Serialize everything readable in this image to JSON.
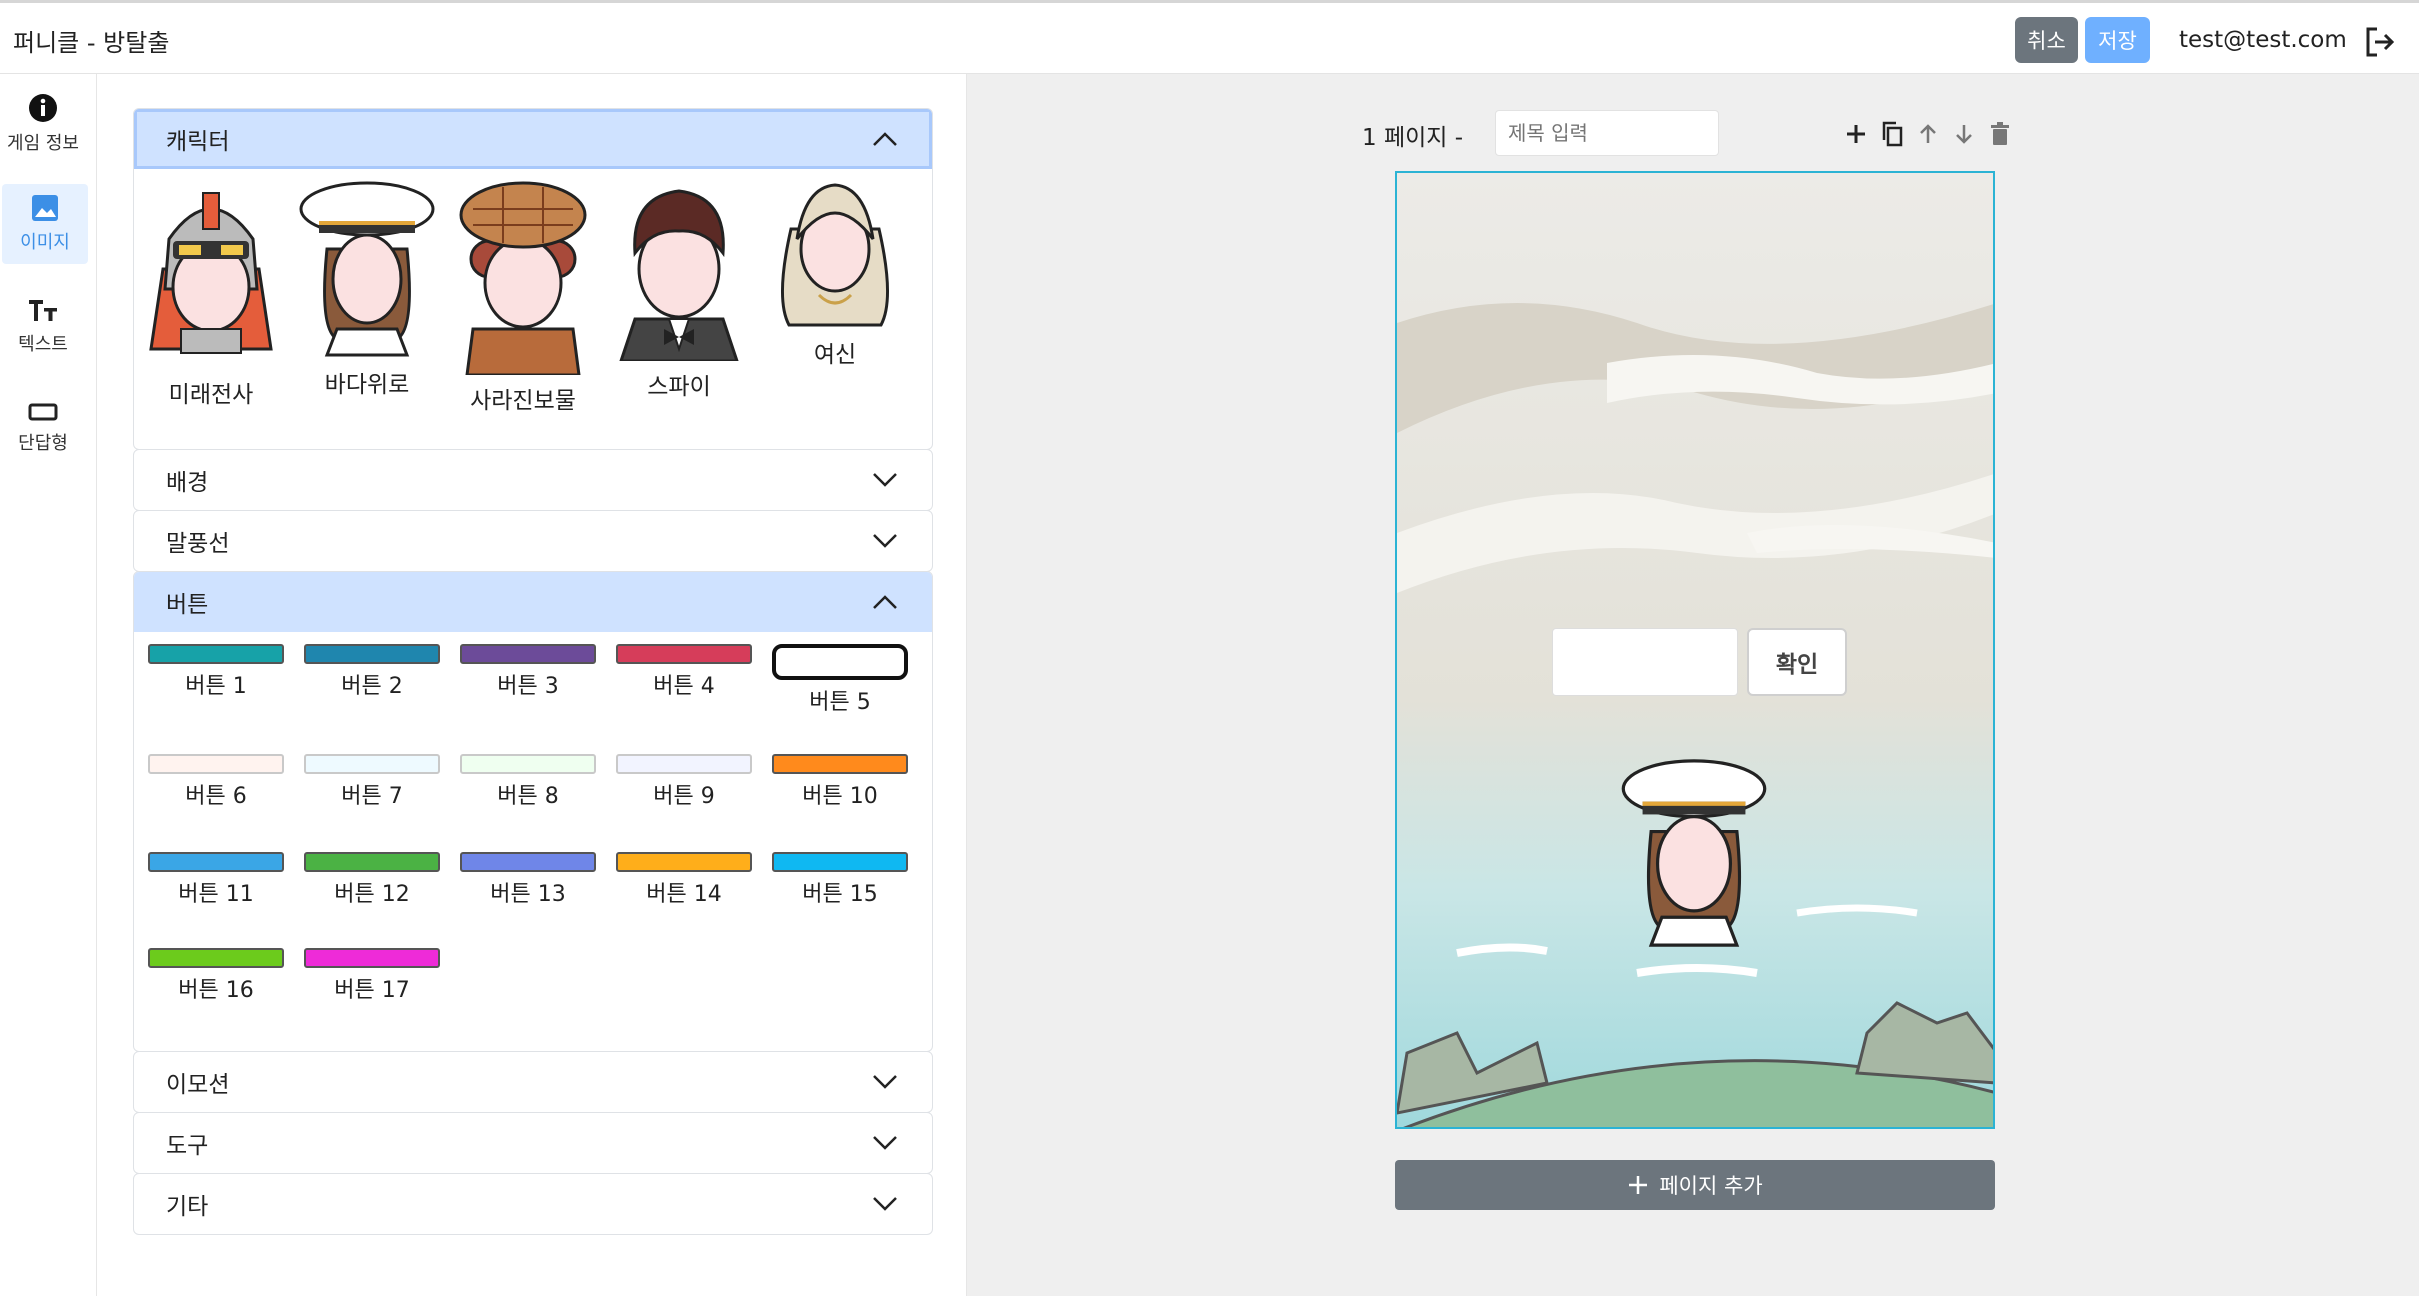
{
  "header": {
    "title": "퍼니클 - 방탈출",
    "cancel_label": "취소",
    "save_label": "저장",
    "user_email": "test@test.com"
  },
  "rail": {
    "items": [
      {
        "label": "게임 정보",
        "icon": "info-icon",
        "active": false
      },
      {
        "label": "이미지",
        "icon": "image-icon",
        "active": true
      },
      {
        "label": "텍스트",
        "icon": "text-icon",
        "active": false
      },
      {
        "label": "단답형",
        "icon": "short-answer-icon",
        "active": false
      }
    ]
  },
  "panel": {
    "sections": {
      "character": {
        "label": "캐릭터",
        "open": true
      },
      "background": {
        "label": "배경",
        "open": false
      },
      "speech": {
        "label": "말풍선",
        "open": false
      },
      "button": {
        "label": "버튼",
        "open": true
      },
      "emotion": {
        "label": "이모션",
        "open": false
      },
      "tool": {
        "label": "도구",
        "open": false
      },
      "etc": {
        "label": "기타",
        "open": false
      }
    },
    "characters": [
      "미래전사",
      "바다위로",
      "사라진보물",
      "스파이",
      "여신"
    ],
    "buttons": [
      {
        "label": "버튼 1",
        "color": "#17a2a8"
      },
      {
        "label": "버튼 2",
        "color": "#1f86ae"
      },
      {
        "label": "버튼 3",
        "color": "#6c4b99"
      },
      {
        "label": "버튼 4",
        "color": "#d63d5a"
      },
      {
        "label": "버튼 5",
        "color": "#ffffff"
      },
      {
        "label": "버튼 6",
        "color": "#fff3ef"
      },
      {
        "label": "버튼 7",
        "color": "#eefaff"
      },
      {
        "label": "버튼 8",
        "color": "#effff0"
      },
      {
        "label": "버튼 9",
        "color": "#f2f4ff"
      },
      {
        "label": "버튼 10",
        "color": "#ff8a1c"
      },
      {
        "label": "버튼 11",
        "color": "#3aa6e6"
      },
      {
        "label": "버튼 12",
        "color": "#4bb244"
      },
      {
        "label": "버튼 13",
        "color": "#6f86e8"
      },
      {
        "label": "버튼 14",
        "color": "#ffae1a"
      },
      {
        "label": "버튼 15",
        "color": "#0fb8f2"
      },
      {
        "label": "버튼 16",
        "color": "#6ccb1c"
      },
      {
        "label": "버튼 17",
        "color": "#ee2bd8"
      }
    ]
  },
  "workspace": {
    "page_label": "1 페이지 -",
    "title_placeholder": "제목 입력",
    "confirm_label": "확인",
    "add_page_label": "페이지 추가"
  }
}
